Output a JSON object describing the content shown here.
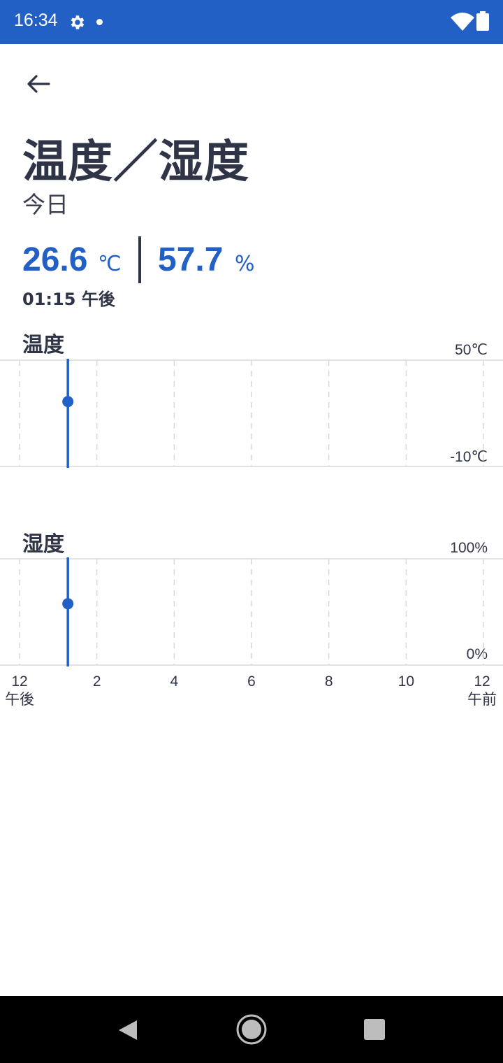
{
  "status_bar": {
    "time": "16:34"
  },
  "page": {
    "title": "温度／湿度",
    "subtitle": "今日"
  },
  "reading": {
    "temperature": "26.6",
    "temperature_unit": "℃",
    "humidity": "57.7",
    "humidity_unit": "%",
    "time": "01:15 午後"
  },
  "charts": {
    "temperature": {
      "title": "温度",
      "max_label": "50℃",
      "min_label": "-10℃"
    },
    "humidity": {
      "title": "湿度",
      "max_label": "100%",
      "min_label": "0%"
    }
  },
  "x_axis": {
    "ticks": [
      {
        "label": "12",
        "sub": "午後"
      },
      {
        "label": "2",
        "sub": ""
      },
      {
        "label": "4",
        "sub": ""
      },
      {
        "label": "6",
        "sub": ""
      },
      {
        "label": "8",
        "sub": ""
      },
      {
        "label": "10",
        "sub": ""
      },
      {
        "label": "12",
        "sub": "午前"
      }
    ]
  },
  "chart_data": [
    {
      "type": "line",
      "title": "温度",
      "ylabel": "",
      "ylim": [
        -10,
        50
      ],
      "x": [
        "13:15"
      ],
      "series": [
        {
          "values": [
            26.6
          ]
        }
      ],
      "xlim": [
        "12:00",
        "24:00"
      ],
      "grid": true
    },
    {
      "type": "line",
      "title": "湿度",
      "ylabel": "",
      "ylim": [
        0,
        100
      ],
      "x": [
        "13:15"
      ],
      "series": [
        {
          "values": [
            57.7
          ]
        }
      ],
      "xlim": [
        "12:00",
        "24:00"
      ],
      "grid": true
    }
  ],
  "colors": {
    "accent": "#2260c6",
    "text": "#2f3447",
    "status_bar": "#2260c6"
  },
  "icons": {
    "back": "arrow-left-icon",
    "settings": "gear-icon",
    "wifi": "wifi-icon",
    "battery": "battery-icon"
  }
}
